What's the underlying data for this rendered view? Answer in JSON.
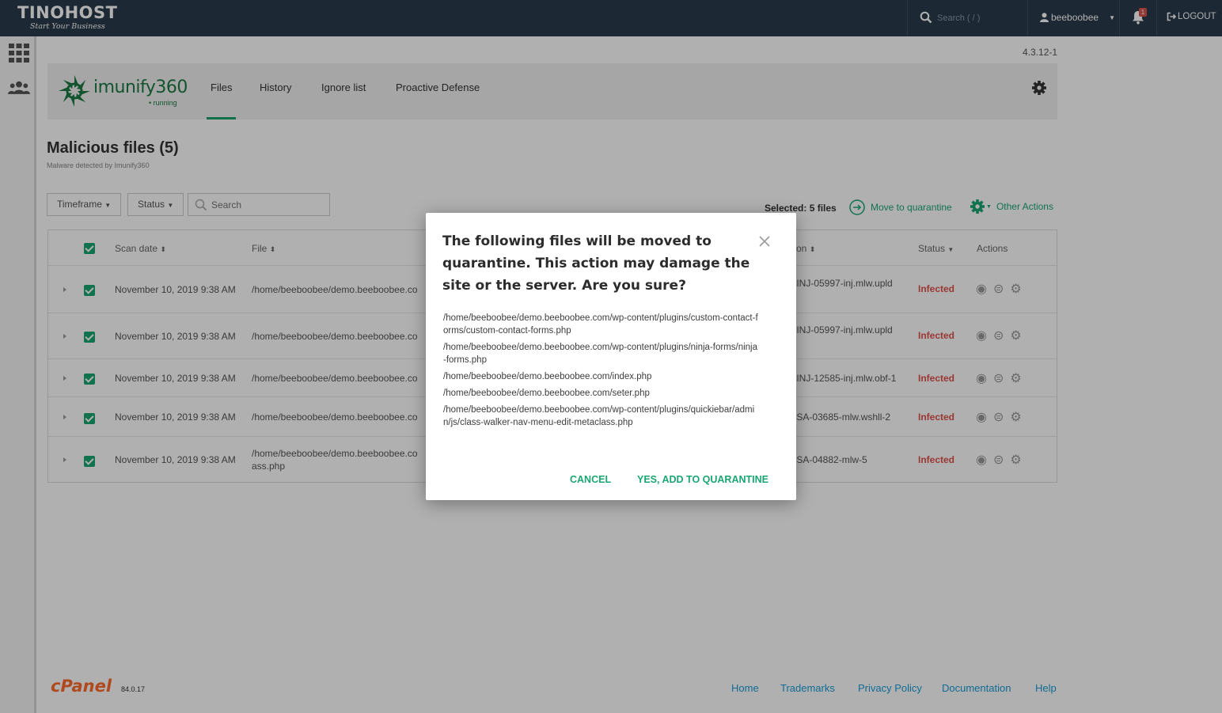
{
  "topbar": {
    "brand_name": "TINOHOST",
    "brand_tagline": "Start Your Business",
    "search_placeholder": "Search ( / )",
    "username": "beeboobee",
    "notification_count": "1",
    "logout_label": "LOGOUT"
  },
  "plugin": {
    "version": "4.3.12-1",
    "logo_text": "imunify360",
    "logo_status": "• running",
    "tabs": [
      {
        "label": "Files",
        "active": true
      },
      {
        "label": "History"
      },
      {
        "label": "Ignore list"
      },
      {
        "label": "Proactive Defense"
      }
    ]
  },
  "section": {
    "title": "Malicious files (5)",
    "subtitle": "Malware detected by Imunify360"
  },
  "filters": {
    "timeframe_label": "Timeframe",
    "status_label": "Status",
    "search_placeholder": "Search"
  },
  "bulk": {
    "selected_label": "Selected: 5 files",
    "move_label": "Move to quarantine",
    "other_label": "Other Actions"
  },
  "table": {
    "headers": {
      "scan_date": "Scan date",
      "file": "File",
      "reason": "on",
      "status": "Status",
      "actions": "Actions"
    },
    "rows": [
      {
        "date": "November 10, 2019 9:38 AM",
        "file": "/home/beeboobee/demo.beeboobee.co",
        "file2": "",
        "reason": "/-INJ-05997-inj.mlw.upld",
        "status": "Infected"
      },
      {
        "date": "November 10, 2019 9:38 AM",
        "file": "/home/beeboobee/demo.beeboobee.co",
        "file2": "",
        "reason": "/-INJ-05997-inj.mlw.upld",
        "status": "Infected"
      },
      {
        "date": "November 10, 2019 9:38 AM",
        "file": "/home/beeboobee/demo.beeboobee.co",
        "file2": "",
        "reason": "/-INJ-12585-inj.mlw.obf-1",
        "status": "Infected"
      },
      {
        "date": "November 10, 2019 9:38 AM",
        "file": "/home/beeboobee/demo.beeboobee.co",
        "file2": "",
        "reason": "/-SA-03685-mlw.wshll-2",
        "status": "Infected"
      },
      {
        "date": "November 10, 2019 9:38 AM",
        "file": "/home/beeboobee/demo.beeboobee.co",
        "file2": "ass.php",
        "reason": "/-SA-04882-mlw-5",
        "status": "Infected"
      }
    ]
  },
  "footer": {
    "cpanel_logo": "cPanel",
    "cpanel_version": "84.0.17",
    "links": [
      "Home",
      "Trademarks",
      "Privacy Policy",
      "Documentation",
      "Help"
    ]
  },
  "modal": {
    "title": "The following files will be moved to quarantine. This action may damage the site or the server. Are you sure?",
    "files": [
      "/home/beeboobee/demo.beeboobee.com/wp-content/plugins/custom-contact-forms/custom-contact-forms.php",
      "/home/beeboobee/demo.beeboobee.com/wp-content/plugins/ninja-forms/ninja-forms.php",
      "/home/beeboobee/demo.beeboobee.com/index.php",
      "/home/beeboobee/demo.beeboobee.com/seter.php",
      "/home/beeboobee/demo.beeboobee.com/wp-content/plugins/quickiebar/admin/js/class-walker-nav-menu-edit-metaclass.php"
    ],
    "cancel_label": "CANCEL",
    "confirm_label": "YES, ADD TO QUARANTINE"
  },
  "colors": {
    "topbar": "#293a4a",
    "accent": "#1aa673",
    "infected": "#e0504b",
    "link": "#179bd7",
    "cpanel": "#ff6c2c"
  }
}
